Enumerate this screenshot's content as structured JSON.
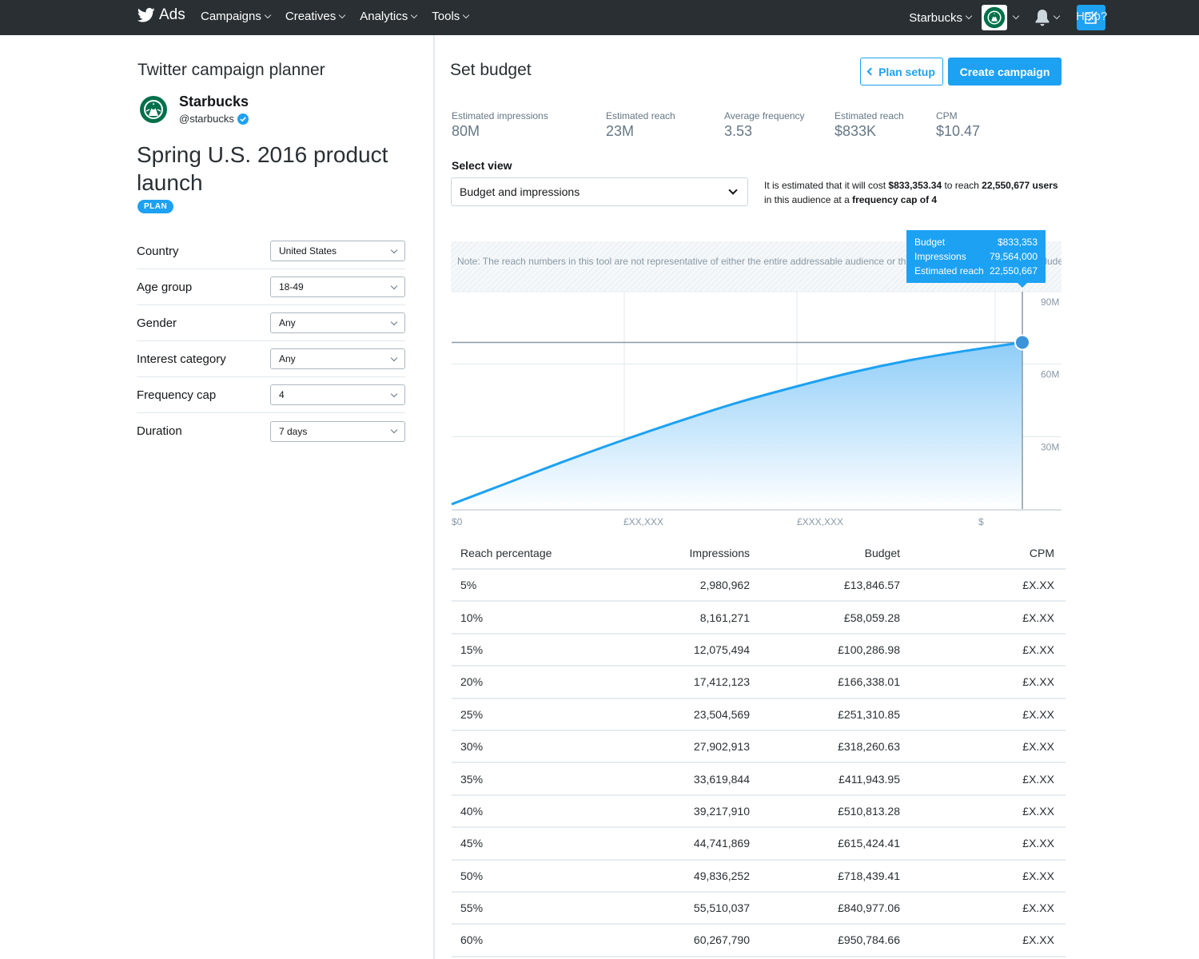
{
  "nav": {
    "brand": "Ads",
    "menu": [
      {
        "label": "Campaigns"
      },
      {
        "label": "Creatives"
      },
      {
        "label": "Analytics"
      },
      {
        "label": "Tools"
      }
    ],
    "account": "Starbucks",
    "help": "Help?",
    "icons": [
      "twitter-bird-icon",
      "bell-icon",
      "compose-icon"
    ]
  },
  "left": {
    "title": "Twitter campaign planner",
    "account_name": "Starbucks",
    "account_handle": "@starbucks",
    "campaign_name": "Spring U.S. 2016 product launch",
    "badge": "PLAN",
    "fields": [
      {
        "label": "Country",
        "value": "United States"
      },
      {
        "label": "Age group",
        "value": "18-49"
      },
      {
        "label": "Gender",
        "value": "Any"
      },
      {
        "label": "Interest category",
        "value": "Any"
      },
      {
        "label": "Frequency cap",
        "value": "4"
      },
      {
        "label": "Duration",
        "value": "7 days"
      }
    ]
  },
  "main": {
    "title": "Set budget",
    "plan_setup_label": "Plan setup",
    "create_label": "Create campaign",
    "metrics": [
      {
        "label": "Estimated impressions",
        "value": "80M"
      },
      {
        "label": "Estimated reach",
        "value": "23M"
      },
      {
        "label": "Average frequency",
        "value": "3.53"
      },
      {
        "label": "Estimated reach",
        "value": "$833K"
      },
      {
        "label": "CPM",
        "value": "$10.47"
      }
    ],
    "select_view_label": "Select view",
    "select_view_value": "Budget and impressions",
    "estimate": {
      "p1": "It is estimated that it will cost ",
      "cost": "$833,353.34",
      "p2": " to reach ",
      "users": "22,550,677 users",
      "p3": " in this audience at a ",
      "cap": "frequency cap of 4"
    },
    "note": "Note: The reach numbers in this tool are not representative of either the entire addressable audience or the total Twitter audience, as it excludes certain groups of users and products.",
    "tooltip": [
      {
        "label": "Budget",
        "value": "$833,353"
      },
      {
        "label": "Impressions",
        "value": "79,564,000"
      },
      {
        "label": "Estimated reach",
        "value": "22,550,667"
      }
    ]
  },
  "chart_data": {
    "type": "area",
    "y_ticks": [
      "90M",
      "60M",
      "30M"
    ],
    "x_ticks": [
      "$0",
      "£XX,XXX",
      "£XXX,XXX",
      "$"
    ],
    "ylim": [
      0,
      90
    ],
    "x": [
      0,
      0.1,
      0.2,
      0.3,
      0.4,
      0.5,
      0.6,
      0.7,
      0.8,
      0.9,
      1.0
    ],
    "series": [
      {
        "values": [
          2,
          11,
          20,
          28.5,
          36.5,
          44,
          50.5,
          56.5,
          61.5,
          65.5,
          69
        ]
      }
    ],
    "selected": {
      "x": 1.0,
      "y": 69
    },
    "reference_line_y": 69,
    "grid": true
  },
  "table": {
    "headers": [
      "Reach percentage",
      "Impressions",
      "Budget",
      "CPM"
    ],
    "rows": [
      [
        "5%",
        "2,980,962",
        "£13,846.57",
        "£X.XX"
      ],
      [
        "10%",
        "8,161,271",
        "£58,059.28",
        "£X.XX"
      ],
      [
        "15%",
        "12,075,494",
        "£100,286.98",
        "£X.XX"
      ],
      [
        "20%",
        "17,412,123",
        "£166,338.01",
        "£X.XX"
      ],
      [
        "25%",
        "23,504,569",
        "£251,310.85",
        "£X.XX"
      ],
      [
        "30%",
        "27,902,913",
        "£318,260.63",
        "£X.XX"
      ],
      [
        "35%",
        "33,619,844",
        "£411,943.95",
        "£X.XX"
      ],
      [
        "40%",
        "39,217,910",
        "£510,813.28",
        "£X.XX"
      ],
      [
        "45%",
        "44,741,869",
        "£615,424.41",
        "£X.XX"
      ],
      [
        "50%",
        "49,836,252",
        "£718,439.41",
        "£X.XX"
      ],
      [
        "55%",
        "55,510,037",
        "£840,977.06",
        "£X.XX"
      ],
      [
        "60%",
        "60,267,790",
        "£950,784.66",
        "£X.XX"
      ]
    ]
  },
  "colors": {
    "topbar": "#292f33",
    "accent": "#1da1f2",
    "line": "#1da1f2",
    "area_top": "#8ecdf8",
    "area_bottom": "#ffffff",
    "starbucks_green": "#00704a"
  }
}
